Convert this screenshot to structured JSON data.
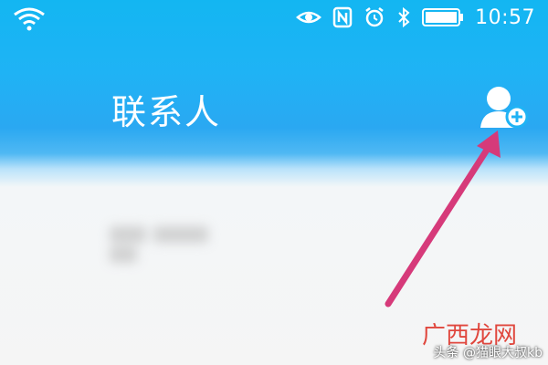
{
  "status_bar": {
    "time": "10:57",
    "icons": [
      "wifi-icon",
      "eye-icon",
      "nfc-icon",
      "alarm-icon",
      "bluetooth-icon",
      "battery-icon"
    ]
  },
  "header": {
    "title": "联系人",
    "add_contact_icon": "add-contact-icon"
  },
  "watermark": {
    "logo": "广西龙网",
    "credit": "头条 @猫眼大叔kb"
  },
  "colors": {
    "header_blue": "#1fb3f5",
    "arrow": "#d63a7a",
    "white": "#ffffff"
  }
}
